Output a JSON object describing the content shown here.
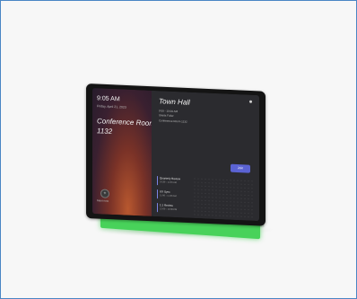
{
  "device": {
    "left_pane": {
      "time": "9:05 AM",
      "date": "Friday, April 21, 2023",
      "room_name": "Conference Room",
      "room_number": "1132",
      "meet_now_label": "Meet now"
    },
    "right_pane": {
      "meeting_title": "Town Hall",
      "meeting_time": "9:00 - 10:00 AM",
      "meeting_organizer": "Sheila Fuller",
      "meeting_location": "Conference Room 1132",
      "join_label": "Join",
      "schedule": [
        {
          "title": "Quarterly Review",
          "subtitle": "10:30 - 11:00 AM"
        },
        {
          "title": "UX Sync",
          "subtitle": "11:00 - 11:30 AM"
        },
        {
          "title": "1:1 Review",
          "subtitle": "12:00 - 12:30 PM"
        }
      ]
    },
    "accent_color": "#5b63d3",
    "led_color": "#48d25a"
  }
}
